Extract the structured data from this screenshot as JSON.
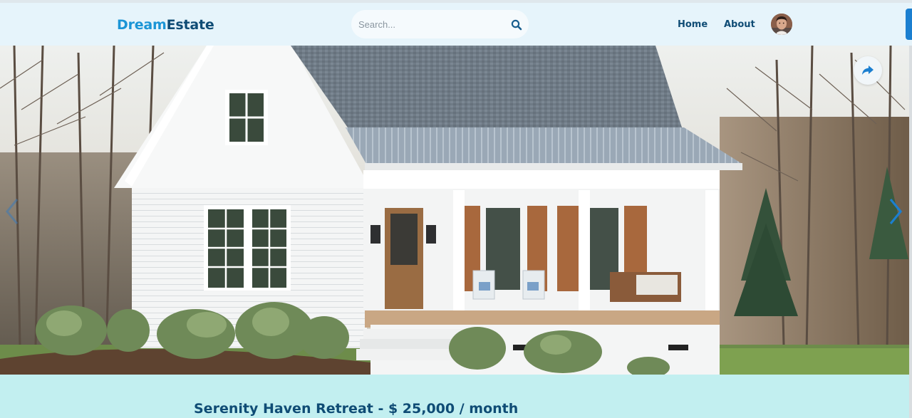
{
  "brand": {
    "name_part1": "Dream",
    "name_part2": "Estate"
  },
  "search": {
    "placeholder": "Search...",
    "value": "",
    "icon": "search-icon"
  },
  "nav": {
    "home": "Home",
    "about": "About"
  },
  "user": {
    "avatar": "user-avatar"
  },
  "hero": {
    "share_icon": "share-icon",
    "prev_icon": "chevron-left-icon",
    "next_icon": "chevron-right-icon"
  },
  "listing": {
    "title": "Serenity Haven Retreat - $ 25,000 / month"
  },
  "colors": {
    "brand_light": "#1b95d6",
    "brand_dark": "#0f4c75",
    "navbar_bg": "#e6f4fb",
    "detail_bg": "#c2eff0",
    "accent": "#1b7fd0"
  }
}
